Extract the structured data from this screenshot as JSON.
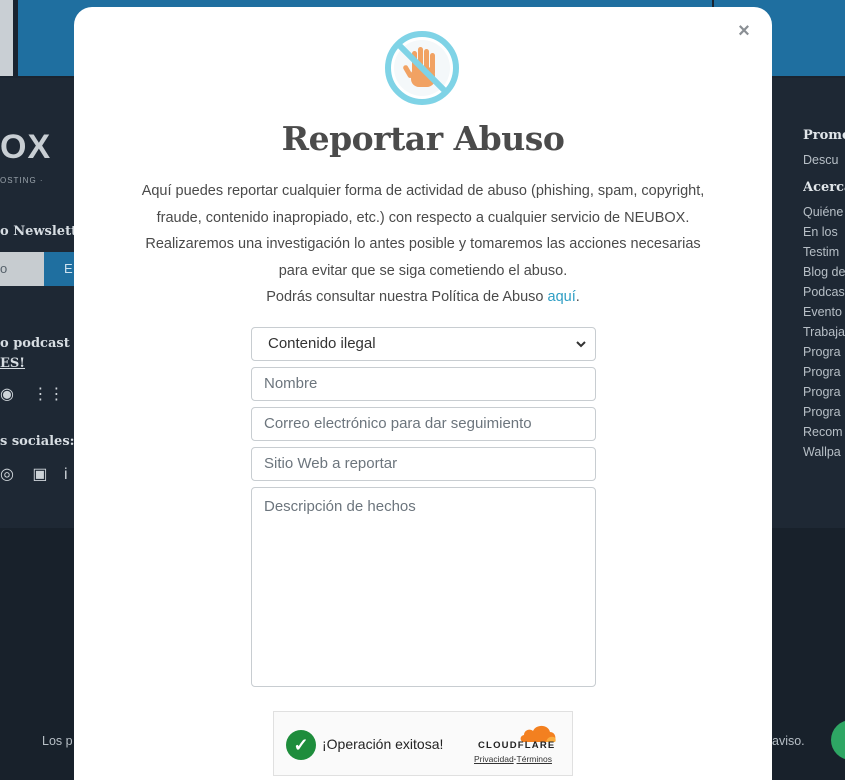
{
  "background": {
    "logo": "OX",
    "logo_sub": "OSTING ·",
    "newsletter_label": "o Newslette",
    "newsletter_input": "o",
    "newsletter_button": "E",
    "podcast_line1": "o podcast",
    "podcast_line2": "ES!",
    "social_label": "s sociales:",
    "right_col": {
      "heading1": "Promo",
      "item1": "Descu",
      "heading2": "Acerca",
      "items": [
        "Quiéne",
        "En los",
        "Testim",
        "Blog de",
        "Podcas",
        "Evento",
        "Trabaja",
        "Progra",
        "Progra",
        "Progra",
        "Progra",
        "Recom",
        "Wallpa"
      ]
    },
    "footer_left": "Los p",
    "footer_right": "aviso."
  },
  "modal": {
    "title": "Reportar Abuso",
    "description": "Aquí puedes reportar cualquier forma de actividad de abuso (phishing, spam, copyright, fraude, contenido inapropiado, etc.) con respecto a cualquier servicio de NEUBOX. Realizaremos una investigación lo antes posible y tomaremos las acciones necesarias para evitar que se siga cometiendo el abuso.",
    "policy_text": "Podrás consultar nuestra Política de Abuso",
    "policy_link": "aquí",
    "policy_end": ".",
    "close_symbol": "×",
    "form": {
      "category_selected": "Contenido ilegal",
      "name_placeholder": "Nombre",
      "email_placeholder": "Correo electrónico para dar seguimiento",
      "website_placeholder": "Sitio Web a reportar",
      "description_placeholder": "Descripción de hechos"
    },
    "captcha": {
      "status": "¡Operación exitosa!",
      "brand": "CLOUDFLARE",
      "privacy": "Privacidad",
      "separator": "·",
      "terms": "Términos"
    }
  },
  "colors": {
    "accent_link": "#2e9ec4",
    "icon_circle": "#7fd3e6",
    "success_green": "#1e8d3c",
    "cloudflare_orange": "#f38020"
  }
}
